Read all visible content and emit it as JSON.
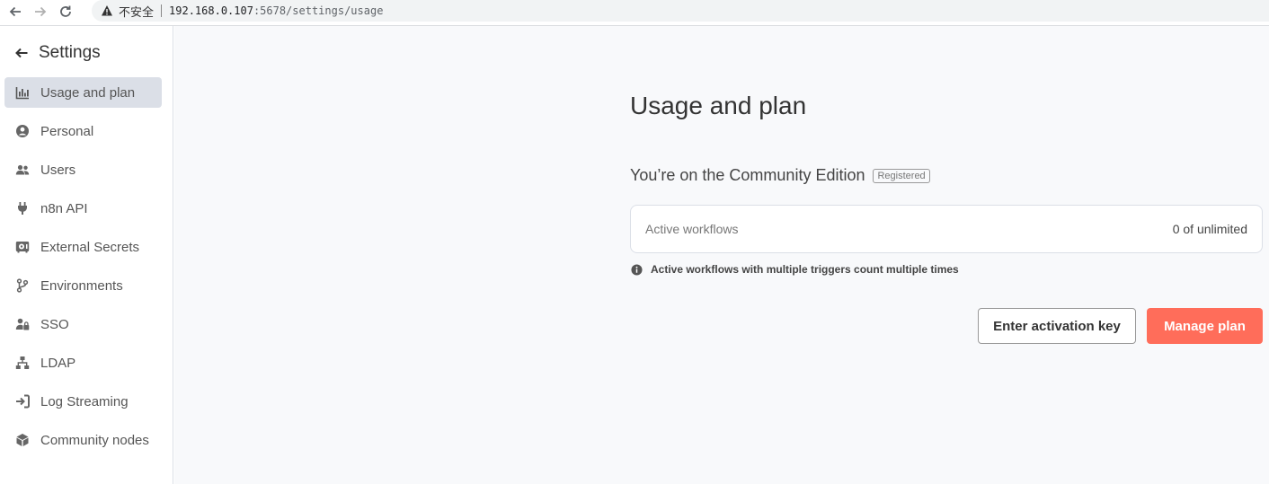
{
  "browser": {
    "insecure_label": "不安全",
    "url_host": "192.168.0.107",
    "url_rest": ":5678/settings/usage"
  },
  "sidebar": {
    "title": "Settings",
    "items": [
      {
        "label": "Usage and plan",
        "icon": "bar-chart-icon",
        "active": true
      },
      {
        "label": "Personal",
        "icon": "user-circle-icon"
      },
      {
        "label": "Users",
        "icon": "users-icon"
      },
      {
        "label": "n8n API",
        "icon": "plug-icon"
      },
      {
        "label": "External Secrets",
        "icon": "vault-icon"
      },
      {
        "label": "Environments",
        "icon": "code-branch-icon"
      },
      {
        "label": "SSO",
        "icon": "user-lock-icon"
      },
      {
        "label": "LDAP",
        "icon": "network-icon"
      },
      {
        "label": "Log Streaming",
        "icon": "sign-in-icon"
      },
      {
        "label": "Community nodes",
        "icon": "cube-icon"
      }
    ]
  },
  "main": {
    "title": "Usage and plan",
    "edition": "You’re on the Community Edition",
    "badge": "Registered",
    "usage": {
      "label": "Active workflows",
      "value": "0 of unlimited"
    },
    "info": "Active workflows with multiple triggers count multiple times",
    "activation_button": "Enter activation key",
    "manage_button": "Manage plan"
  },
  "colors": {
    "accent": "#ff6d5a",
    "sidebar_active": "#dbdfe7",
    "main_bg": "#f8f9fb"
  }
}
